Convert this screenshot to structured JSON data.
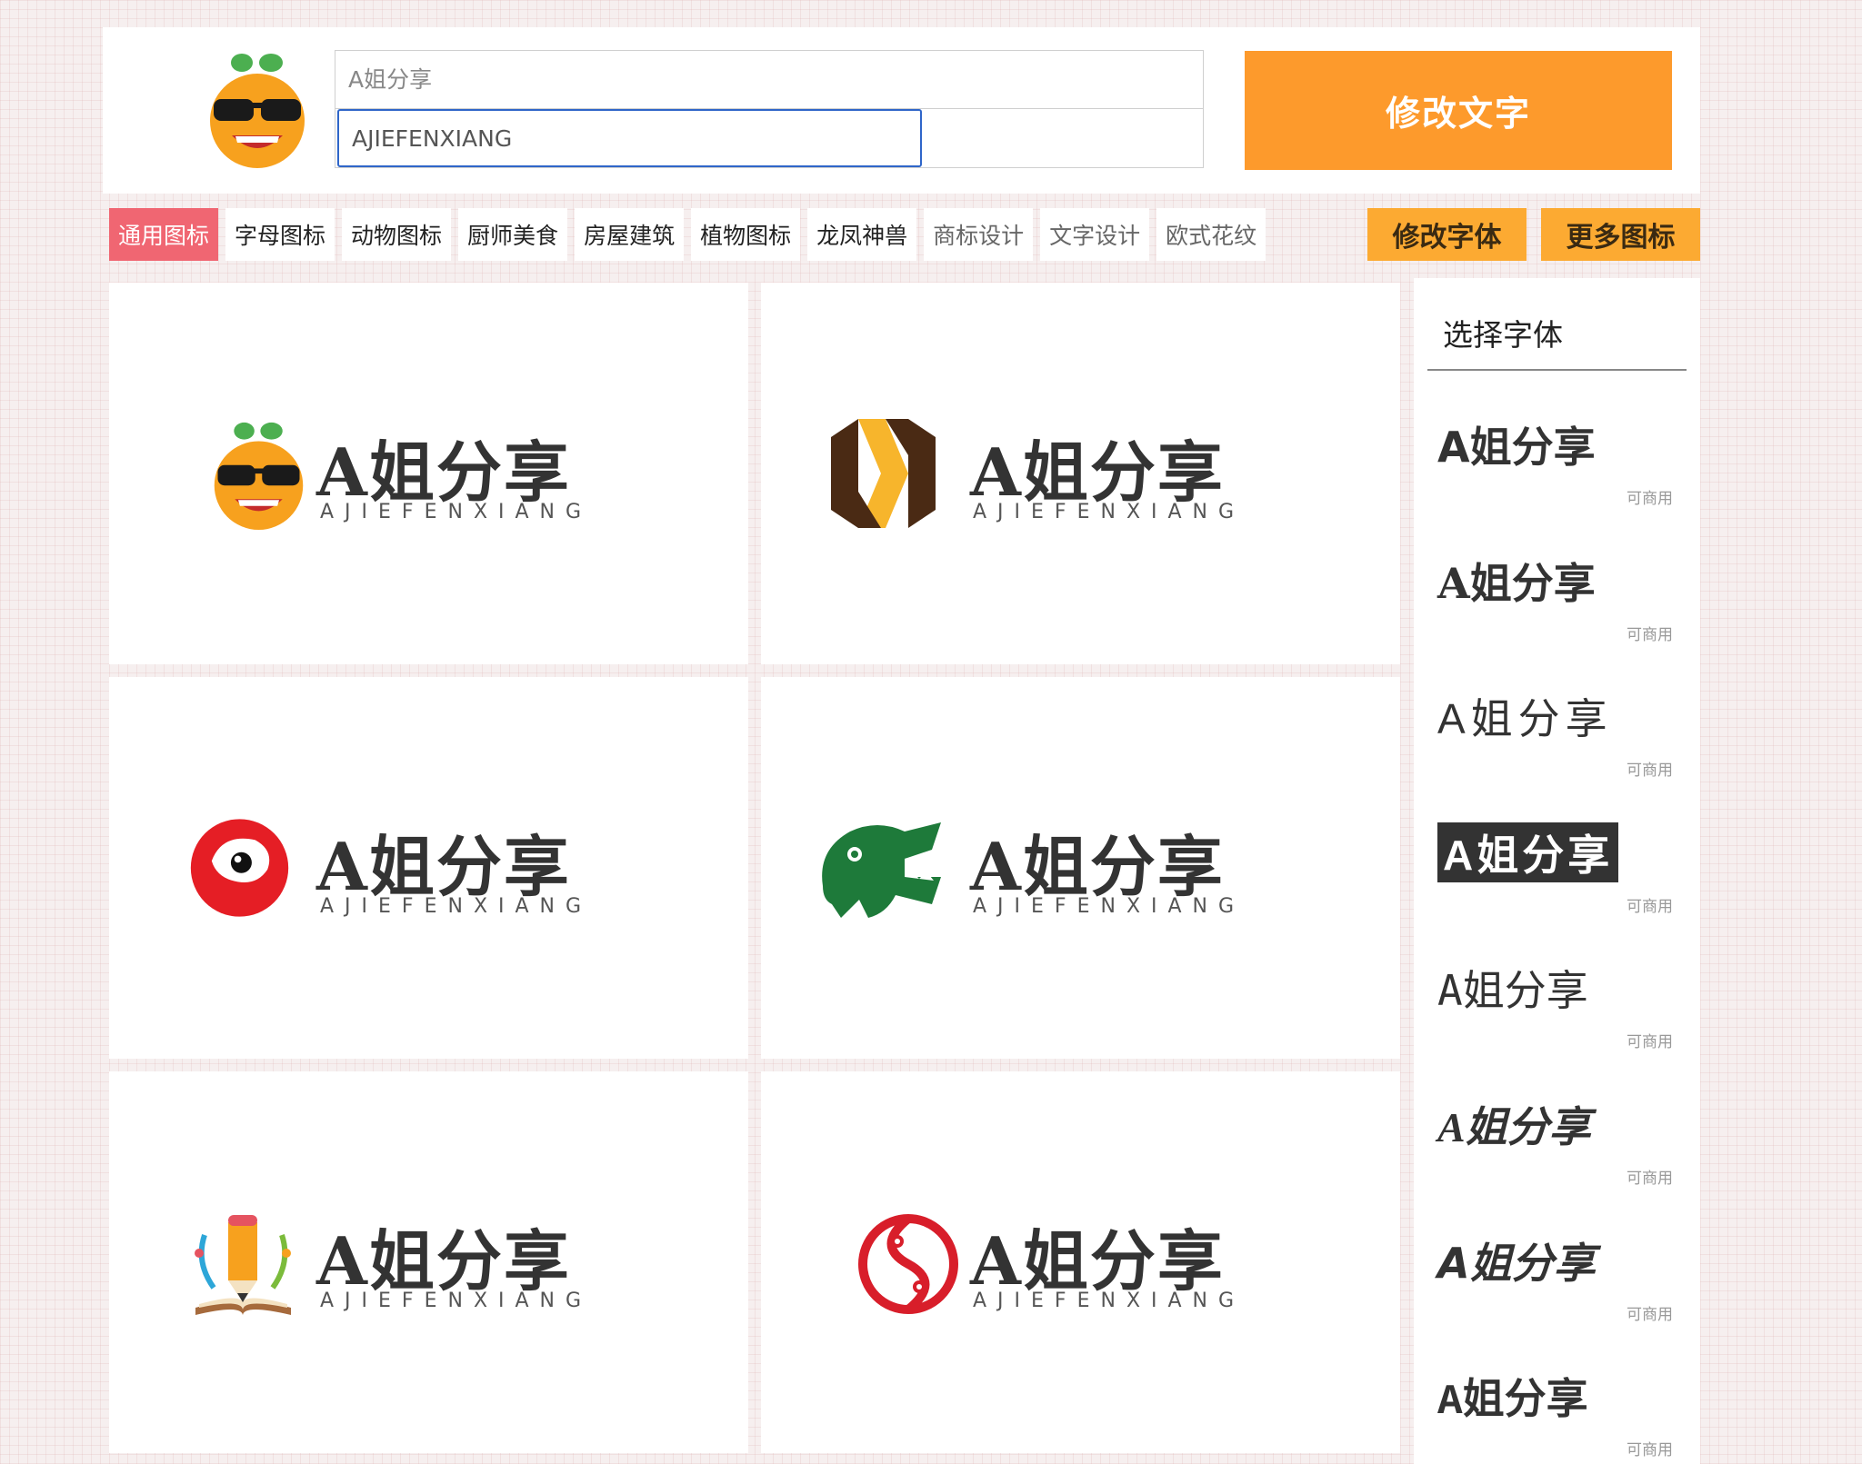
{
  "header": {
    "name_placeholder": "A姐分享",
    "sub_value": "AJIEFENXIANG",
    "modify_label": "修改文字"
  },
  "tabs": [
    {
      "label": "通用图标",
      "active": true
    },
    {
      "label": "字母图标"
    },
    {
      "label": "动物图标"
    },
    {
      "label": "厨师美食"
    },
    {
      "label": "房屋建筑"
    },
    {
      "label": "植物图标"
    },
    {
      "label": "龙凤神兽"
    },
    {
      "label": "商标设计"
    },
    {
      "label": "文字设计"
    },
    {
      "label": "欧式花纹"
    }
  ],
  "tools": {
    "font_label": "修改字体",
    "more_label": "更多图标"
  },
  "cards": [
    {
      "icon": "orange-sunglasses-icon",
      "name": "A姐分享",
      "sub": "AJIEFENXIANG"
    },
    {
      "icon": "hex-ribbon-icon",
      "name": "A姐分享",
      "sub": "AJIEFENXIANG"
    },
    {
      "icon": "red-eye-icon",
      "name": "A姐分享",
      "sub": "AJIEFENXIANG"
    },
    {
      "icon": "crocodile-icon",
      "name": "A姐分享",
      "sub": "AJIEFENXIANG"
    },
    {
      "icon": "pencil-book-icon",
      "name": "A姐分享",
      "sub": "AJIEFENXIANG"
    },
    {
      "icon": "twin-fish-icon",
      "name": "A姐分享",
      "sub": "AJIEFENXIANG"
    }
  ],
  "sidebar": {
    "title": "选择字体",
    "fonts": [
      {
        "sample": "A姐分享",
        "tag": "可商用"
      },
      {
        "sample": "A姐分享",
        "tag": "可商用"
      },
      {
        "sample": "A姐分享",
        "tag": "可商用"
      },
      {
        "sample": "A姐分享",
        "tag": "可商用"
      },
      {
        "sample": "A姐分享",
        "tag": "可商用"
      },
      {
        "sample": "A姐分享",
        "tag": "可商用"
      },
      {
        "sample": "A姐分享",
        "tag": "可商用"
      },
      {
        "sample": "A姐分享",
        "tag": "可商用"
      }
    ]
  },
  "colors": {
    "accent": "#fd9a2c",
    "tab_active": "#f06672",
    "tool_button": "#fcaa32"
  }
}
